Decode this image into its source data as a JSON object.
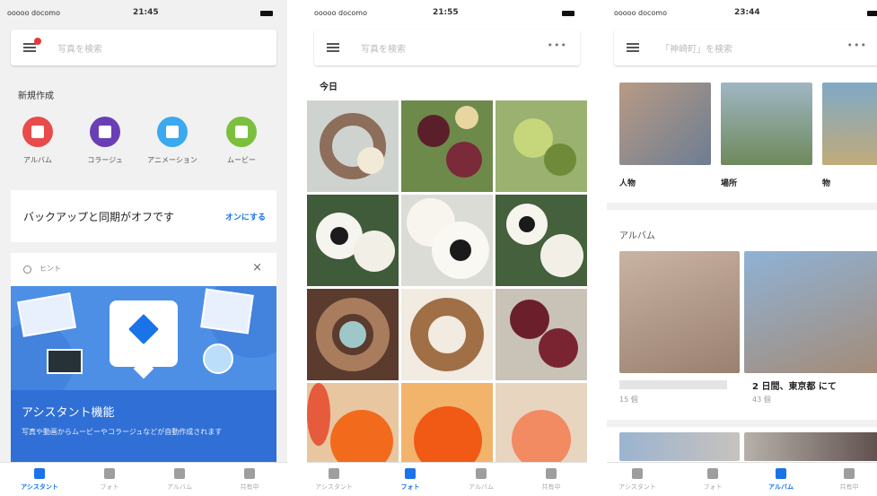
{
  "status": {
    "carrier": "ooooo docomo",
    "times": [
      "21:45",
      "21:55",
      "23:44"
    ]
  },
  "screen1": {
    "search_placeholder": "写真を検索",
    "create_heading": "新規作成",
    "create_items": [
      {
        "label": "アルバム",
        "color": "#e84b4b"
      },
      {
        "label": "コラージュ",
        "color": "#6a3fb5"
      },
      {
        "label": "アニメーション",
        "color": "#3aa9ef"
      },
      {
        "label": "ムービー",
        "color": "#7cbf3f"
      }
    ],
    "backup_text": "バックアップと同期がオフです",
    "backup_button": "オンにする",
    "hint_label": "ヒント",
    "hint_close": "×",
    "assist_title": "アシスタント機能",
    "assist_desc": "写真や動画からムービーやコラージュなどが自動作成されます",
    "active_tab": 0
  },
  "screen2": {
    "search_placeholder": "写真を検索",
    "more": "•••",
    "date_label": "今日",
    "active_tab": 1
  },
  "screen3": {
    "search_placeholder": "「神崎町」を検索",
    "more": "•••",
    "categories": [
      "人物",
      "場所",
      "物"
    ],
    "album_heading": "アルバム",
    "albums": [
      {
        "name": "",
        "count": "15 個"
      },
      {
        "name": "2 日間、東京都 にて",
        "count": "43 個"
      }
    ],
    "active_tab": 2
  },
  "nav_tabs": [
    "アシスタント",
    "フォト",
    "アルバム",
    "共有中"
  ],
  "colors": {
    "accent": "#1a73e8",
    "banner": "#4e8fe6"
  }
}
